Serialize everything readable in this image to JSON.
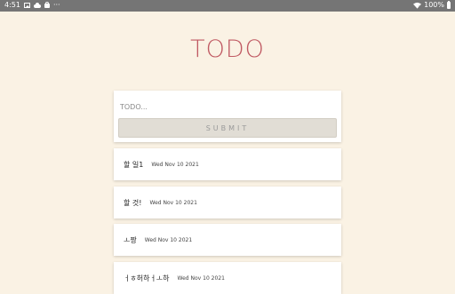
{
  "status_bar": {
    "time": "4:51",
    "battery": "100%",
    "icons": [
      "image-icon",
      "cloud-icon",
      "bag-icon",
      "more-icon",
      "wifi-icon",
      "battery-icon"
    ]
  },
  "app": {
    "title": "TODO",
    "title_color": "#c05a63",
    "background": "#faf2e4"
  },
  "form": {
    "placeholder": "TODO...",
    "value": "",
    "submit_label": "SUBMIT"
  },
  "todos": [
    {
      "text": "할 일1",
      "date": "Wed Nov 10 2021"
    },
    {
      "text": "할 것!",
      "date": "Wed Nov 10 2021"
    },
    {
      "text": "ㅗ짱",
      "date": "Wed Nov 10 2021"
    },
    {
      "text": "ㅓㅎ허하ㅓㅗ하",
      "date": "Wed Nov 10 2021"
    }
  ]
}
